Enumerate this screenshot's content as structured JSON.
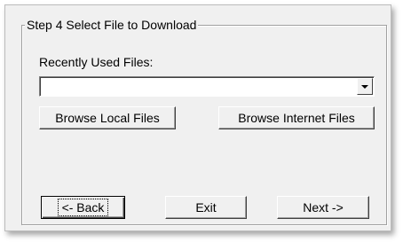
{
  "groupbox": {
    "title": "Step 4 Select File to Download"
  },
  "recent": {
    "label": "Recently Used Files:",
    "selected_value": ""
  },
  "buttons": {
    "browse_local": "Browse Local Files",
    "browse_internet": "Browse Internet Files",
    "back": "<- Back",
    "exit": "Exit",
    "next": "Next ->"
  }
}
